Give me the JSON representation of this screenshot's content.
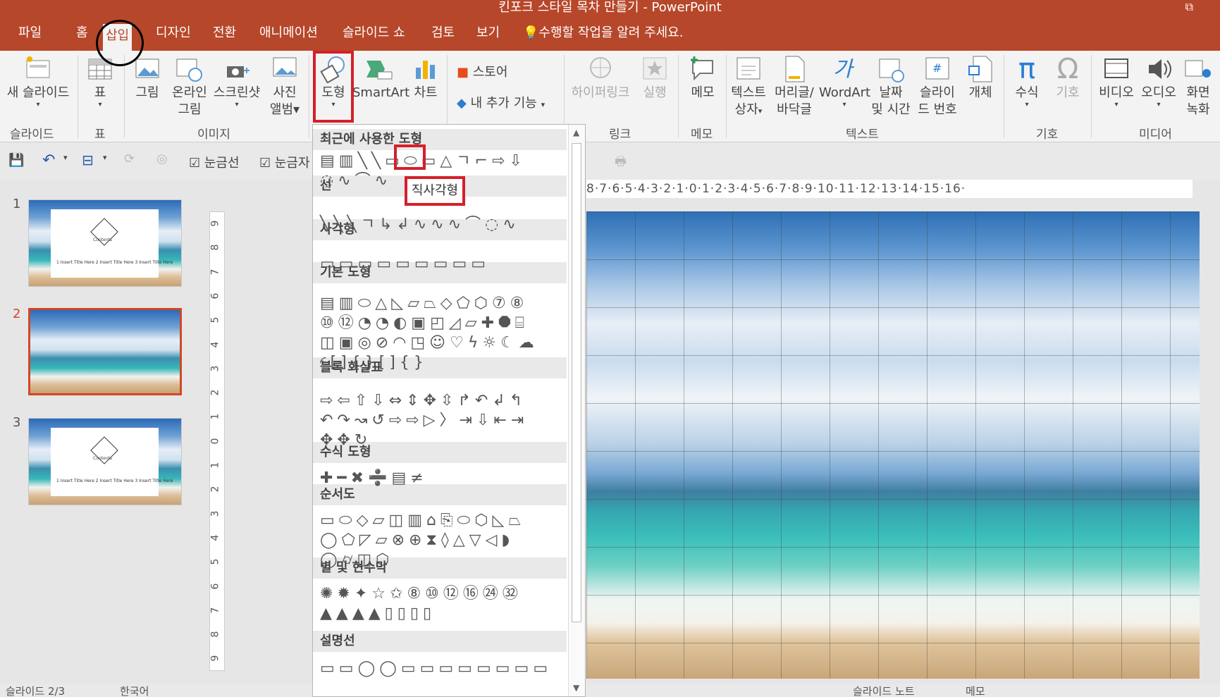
{
  "window": {
    "title": "킨포크 스타일 목차 만들기 - PowerPoint",
    "restore_glyph": "⧉"
  },
  "tabs": [
    "파일",
    "홈",
    "삽입",
    "디자인",
    "전환",
    "애니메이션",
    "슬라이드 쇼",
    "검토",
    "보기"
  ],
  "tell_me": "수행할 작업을 알려 주세요.",
  "ribbon": {
    "new_slide": "새 슬라이드",
    "slides_group": "슬라이드",
    "table": "표",
    "table_group": "표",
    "picture": "그림",
    "online_picture_1": "온라인",
    "online_picture_2": "그림",
    "screenshot": "스크린샷",
    "album_1": "사진",
    "album_2": "앨범",
    "images_group": "이미지",
    "shapes": "도형",
    "smartart": "SmartArt",
    "chart": "차트",
    "store": "스토어",
    "my_addins": "내 추가 기능",
    "hyperlink": "하이퍼링크",
    "action": "실행",
    "links_group": "링크",
    "comment": "메모",
    "comments_group": "메모",
    "textbox_1": "텍스트",
    "textbox_2": "상자",
    "header_1": "머리글/",
    "header_2": "바닥글",
    "wordart": "WordArt",
    "datetime_1": "날짜",
    "datetime_2": "및 시간",
    "slidenum_1": "슬라이",
    "slidenum_2": "드 번호",
    "object": "개체",
    "text_group": "텍스트",
    "equation": "수식",
    "symbol": "기호",
    "symbols_group": "기호",
    "video": "비디오",
    "audio": "오디오",
    "screenrec_1": "화면",
    "screenrec_2": "녹화",
    "media_group": "미디어"
  },
  "qat": {
    "gridlines": "눈금선",
    "guides": "눈금자"
  },
  "slides": [
    {
      "num": "1",
      "label": "Contents"
    },
    {
      "num": "2"
    },
    {
      "num": "3",
      "label": "Contents"
    }
  ],
  "thumb_items": "1 Insert Title Here   2 Insert Title Here   3 Insert Title Here",
  "vruler": [
    "9",
    "8",
    "7",
    "6",
    "5",
    "4",
    "3",
    "2",
    "1",
    "0",
    "1",
    "2",
    "3",
    "4",
    "5",
    "6",
    "7",
    "8",
    "9"
  ],
  "hruler": "8·7·6·5·4·3·2·1·0·1·2·3·4·5·6·7·8·9·10·11·12·13·14·15·16·",
  "gallery": {
    "sections": [
      "최근에 사용한 도형",
      "선",
      "사각형",
      "기본 도형",
      "블록 화살표",
      "수식 도형",
      "순서도",
      "별 및 현수막",
      "설명선"
    ],
    "rows": [
      "▤▥╲╲▭⬭▭△ㄱ⌐⇨⇩",
      "◌∿⌒∿",
      "╲╲╲ㄱ↳↲∿∿∿⌒◌∿",
      "▭▭▭▭▭▭▭▭▭",
      "▤▥⬭△◺▱⏢◇⬠⬡⑦⑧",
      "⑩⑫◔◔◐▣◰◿▱✚⯃⌸",
      "◫▣◎⊘◠◳☺♡ϟ☼☾☁",
      "◜[]{}[]{}",
      "⇨⇦⇧⇩⇔⇕✥⇳↱↶↲↰",
      "↶↷↝↺⇨⇨▷〉⇥⇩⇤⇥",
      "✥✥↻",
      "✚━✖➗▤≠",
      "▭⬭◇▱◫▥⌂⎘⬭⬡◺⏢",
      "◯⬠◸▱⊗⊕⧗◊△▽◁◗",
      "◯⌭◫⬡",
      "✺✹✦☆✩⑧⑩⑫⑯㉔㉜",
      "▲▲▲▲▯▯▯▯",
      "▭▭◯◯▭▭▭▭▭▭▭▭"
    ],
    "tooltip": "직사각형"
  },
  "status": {
    "left": "슬라이드 2/3",
    "lang": "한국어",
    "notes": "슬라이드 노트",
    "comments": "메모"
  }
}
